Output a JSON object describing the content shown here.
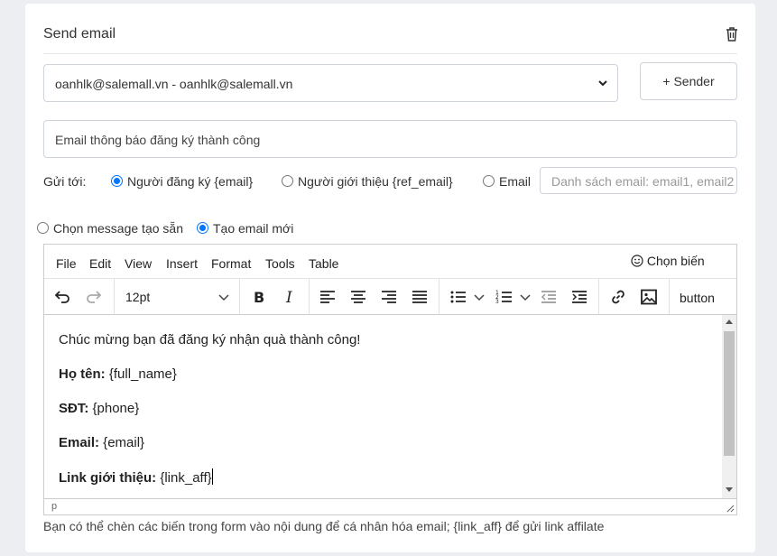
{
  "card": {
    "title": "Send email"
  },
  "sender": {
    "selected": "oanhlk@salemall.vn - oanhlk@salemall.vn",
    "add_button": "+ Sender"
  },
  "subject": {
    "value": "Email thông báo đăng ký thành công"
  },
  "recipients": {
    "label": "Gửi tới:",
    "options": [
      {
        "label": "Người đăng ký {email}",
        "checked": true
      },
      {
        "label": "Người giới thiệu {ref_email}",
        "checked": false
      },
      {
        "label": "Email",
        "checked": false
      }
    ],
    "email_list_placeholder": "Danh sách email: email1, email2"
  },
  "message_mode": {
    "options": [
      {
        "label": "Chọn message tạo sẵn",
        "checked": false
      },
      {
        "label": "Tạo email mới",
        "checked": true
      }
    ]
  },
  "editor": {
    "menu": [
      "File",
      "Edit",
      "View",
      "Insert",
      "Format",
      "Tools",
      "Table"
    ],
    "variables_button": "Chọn biến",
    "font_size": "12pt",
    "custom_button": "button",
    "content": {
      "line1": "Chúc mừng bạn đã đăng ký nhận quà thành công!",
      "name_label": "Họ tên:",
      "name_value": " {full_name}",
      "phone_label": "SĐT:",
      "phone_value": " {phone}",
      "email_label": "Email:",
      "email_value": " {email}",
      "link_label": "Link giới thiệu:",
      "link_value": " {link_aff}"
    },
    "status_path": "p"
  },
  "hint": "Bạn có thể chèn các biến trong form vào nội dung để cá nhân hóa email; {link_aff} để gửi link affilate"
}
